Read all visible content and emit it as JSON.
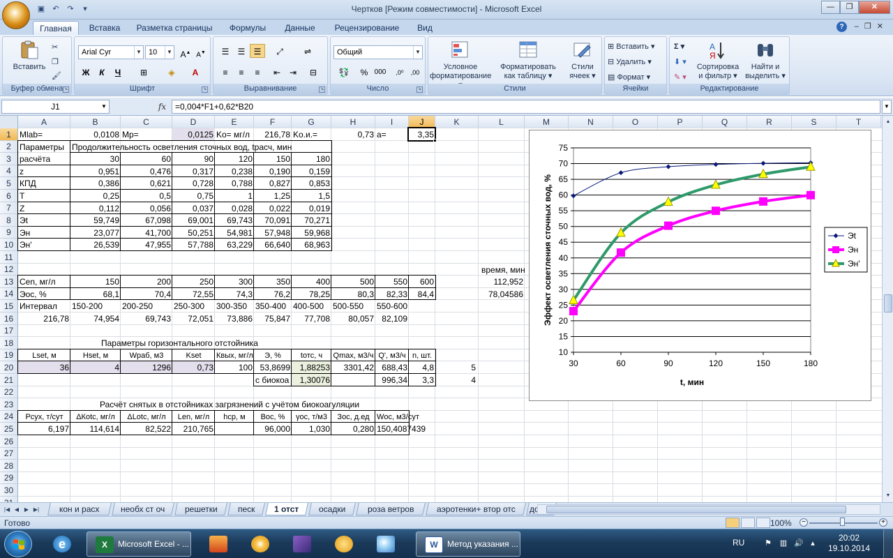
{
  "window": {
    "title": "Чертков  [Режим совместимости] - Microsoft Excel",
    "controls": [
      "—",
      "❐",
      "✕"
    ]
  },
  "ribbon_tabs": [
    "Главная",
    "Вставка",
    "Разметка страницы",
    "Формулы",
    "Данные",
    "Рецензирование",
    "Вид"
  ],
  "ribbon": {
    "clipboard": {
      "name": "Буфер обмена",
      "paste": "Вставить"
    },
    "font": {
      "name": "Шрифт",
      "family": "Arial Cyr",
      "size": "10",
      "bold": "Ж",
      "italic": "К",
      "underline": "Ч"
    },
    "alignment": {
      "name": "Выравнивание"
    },
    "number": {
      "name": "Число",
      "format": "Общий"
    },
    "styles": {
      "name": "Стили",
      "cond_line1": "Условное",
      "cond_line2": "форматирование",
      "table_line1": "Форматировать",
      "table_line2": "как таблицу",
      "cell_line1": "Стили",
      "cell_line2": "ячеек"
    },
    "cells": {
      "name": "Ячейки",
      "insert": "Вставить",
      "delete": "Удалить",
      "format": "Формат"
    },
    "editing": {
      "name": "Редактирование",
      "sort_line1": "Сортировка",
      "sort_line2": "и фильтр",
      "find_line1": "Найти и",
      "find_line2": "выделить"
    }
  },
  "formula_bar": {
    "name_box": "J1",
    "fx": "fx",
    "formula": "=0,004*F1+0,62*B20"
  },
  "columns": [
    "A",
    "B",
    "C",
    "D",
    "E",
    "F",
    "G",
    "H",
    "I",
    "J",
    "K",
    "L",
    "M",
    "N",
    "O",
    "P",
    "Q",
    "R",
    "S",
    "T"
  ],
  "rows": [
    "1",
    "2",
    "3",
    "4",
    "5",
    "6",
    "7",
    "8",
    "9",
    "10",
    "11",
    "12",
    "13",
    "14",
    "15",
    "16",
    "17",
    "18",
    "19",
    "20",
    "21",
    "22",
    "23",
    "24",
    "25",
    "26",
    "27",
    "28",
    "29",
    "30",
    "31"
  ],
  "cells": {
    "r1": {
      "A": "Mlab=",
      "B": "0,0108",
      "C": "Mp=",
      "D": "0,0125",
      "E": "Ko= мг/л",
      "F": "216,78",
      "G": "Ko.и.=",
      "H": "0,73",
      "I": "a=",
      "J": "3,35"
    },
    "r2": {
      "A": "Параметры",
      "B": "Продолжительность осветления сточных вод, tрасч, мин"
    },
    "r3": {
      "A": "расчёта",
      "B": "30",
      "C": "60",
      "D": "90",
      "E": "120",
      "F": "150",
      "G": "180"
    },
    "r4": {
      "A": "z",
      "B": "0,951",
      "C": "0,476",
      "D": "0,317",
      "E": "0,238",
      "F": "0,190",
      "G": "0,159"
    },
    "r5": {
      "A": "КПД",
      "B": "0,386",
      "C": "0,621",
      "D": "0,728",
      "E": "0,788",
      "F": "0,827",
      "G": "0,853"
    },
    "r6": {
      "A": "T",
      "B": "0,25",
      "C": "0,5",
      "D": "0,75",
      "E": "1",
      "F": "1,25",
      "G": "1,5"
    },
    "r7": {
      "A": "Z",
      "B": "0,112",
      "C": "0,056",
      "D": "0,037",
      "E": "0,028",
      "F": "0,022",
      "G": "0,019"
    },
    "r8": {
      "A": "Эt",
      "B": "59,749",
      "C": "67,098",
      "D": "69,001",
      "E": "69,743",
      "F": "70,091",
      "G": "70,271"
    },
    "r9": {
      "A": "Эн",
      "B": "23,077",
      "C": "41,700",
      "D": "50,251",
      "E": "54,981",
      "F": "57,948",
      "G": "59,968"
    },
    "r10": {
      "A": "Эн'",
      "B": "26,539",
      "C": "47,955",
      "D": "57,788",
      "E": "63,229",
      "F": "66,640",
      "G": "68,963"
    },
    "r12": {
      "L": "время, мин"
    },
    "r13": {
      "A": "Сеn, мг/л",
      "B": "150",
      "C": "200",
      "D": "250",
      "E": "300",
      "F": "350",
      "G": "400",
      "H": "500",
      "I": "550",
      "J": "600",
      "L": "112,952"
    },
    "r14": {
      "A": "Эос, %",
      "B": "68,1",
      "C": "70,4",
      "D": "72,55",
      "E": "74,3",
      "F": "76,2",
      "G": "78,25",
      "H": "80,3",
      "I": "82,33",
      "J": "84,4",
      "L": "78,04586"
    },
    "r15": {
      "A": "Интервал",
      "B": "150-200",
      "C": "200-250",
      "D": "250-300",
      "E": "300-350",
      "F": "350-400",
      "G": "400-500",
      "H": "500-550",
      "I": "550-600"
    },
    "r16": {
      "A": "216,78",
      "B": "74,954",
      "C": "69,743",
      "D": "72,051",
      "E": "73,886",
      "F": "75,847",
      "G": "77,708",
      "H": "80,057",
      "I": "82,109"
    },
    "r18": {
      "B": "Параметры горизонтального отстойника"
    },
    "r19": {
      "A": "Lset, м",
      "B": "Hset, м",
      "C": "Wраб, м3",
      "D": "Kset",
      "E": "Квых, мг/л",
      "F": "Э, %",
      "G": "tотс, ч",
      "H": "Qmax, м3/ч",
      "I": "Q', м3/ч",
      "J": "n, шт."
    },
    "r20": {
      "A": "36",
      "B": "4",
      "C": "1296",
      "D": "0,73",
      "E": "100",
      "F": "53,8699",
      "G": "1,88253",
      "H": "3301,42",
      "I": "688,43",
      "J": "4,8",
      "K": "5"
    },
    "r21": {
      "F": "с биокоа",
      "G": "1,30076",
      "I": "996,34",
      "J": "3,3",
      "K": "4"
    },
    "r23": {
      "B": "Расчёт снятых в отстойниках загрязнений с учётом биокоагуляции"
    },
    "r24": {
      "A": "Рсух, т/сут",
      "B": "ΔКotc, мг/л",
      "C": "ΔLotc, мг/л",
      "D": "Len, мг/л",
      "E": "hcp, м",
      "F": "Вос, %",
      "G": "γос, т/м3",
      "H": "Зос, д.ед",
      "I": "Wос, м3/сут"
    },
    "r25": {
      "A": "6,197",
      "B": "114,614",
      "C": "82,522",
      "D": "210,765",
      "F": "96,000",
      "G": "1,030",
      "H": "0,280",
      "I": "150,4087439"
    }
  },
  "chart_data": {
    "type": "line",
    "x": [
      30,
      60,
      90,
      120,
      150,
      180
    ],
    "xlabel": "t, мин",
    "ylabel": "Эффект осветления сточных вод, %",
    "ylim": [
      10,
      75
    ],
    "yticks": [
      10,
      15,
      20,
      25,
      30,
      35,
      40,
      45,
      50,
      55,
      60,
      65,
      70,
      75
    ],
    "grid": "horizontal",
    "legend": "right",
    "series": [
      {
        "name": "Эt",
        "values": [
          59.749,
          67.098,
          69.001,
          69.743,
          70.091,
          70.271
        ],
        "color": "#0a1a7a",
        "marker": "diamond"
      },
      {
        "name": "Эн",
        "values": [
          23.077,
          41.7,
          50.251,
          54.981,
          57.948,
          59.968
        ],
        "color": "#ff00ff",
        "marker": "square"
      },
      {
        "name": "Эн'",
        "values": [
          26.539,
          47.955,
          57.788,
          63.229,
          66.64,
          68.963
        ],
        "color": "#2e9a6a",
        "marker": "triangle"
      }
    ]
  },
  "sheet_tabs": [
    "кон и расх",
    "необх ст оч",
    "решетки",
    "песк",
    "1 отст",
    "осадки",
    "роза ветров",
    "аэротенки+ втор отс",
    "доочи"
  ],
  "active_sheet": "1 отст",
  "status": {
    "ready": "Готово",
    "zoom": "100%"
  },
  "taskbar": {
    "items": [
      "Microsoft Excel - ...",
      "Метод указания ..."
    ],
    "lang": "RU",
    "time": "20:02",
    "date": "19.10.2014"
  }
}
